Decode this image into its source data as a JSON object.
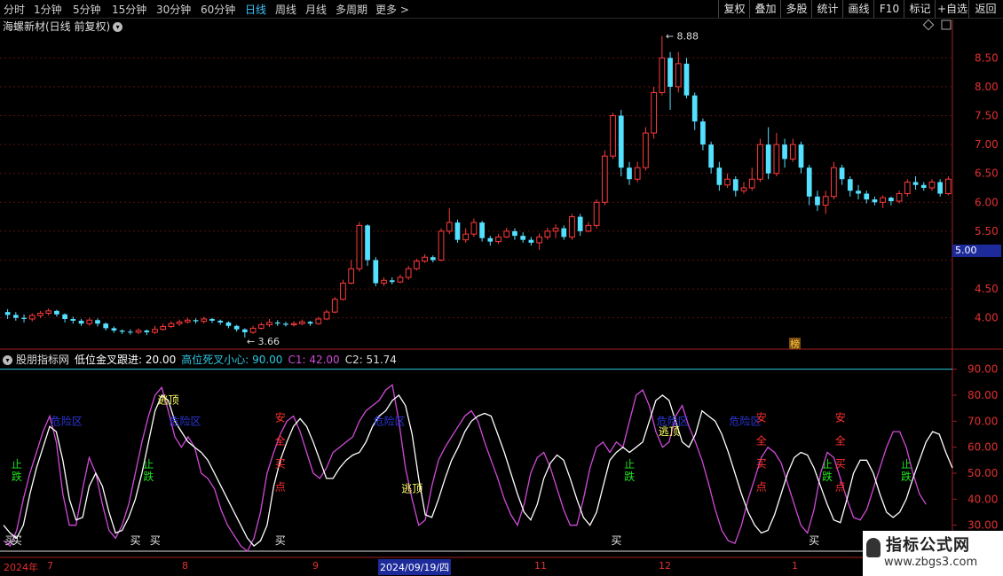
{
  "toolbar": {
    "timeframes": [
      "分时",
      "1分钟",
      "5分钟",
      "15分钟",
      "30分钟",
      "60分钟",
      "日线",
      "周线",
      "月线",
      "多周期",
      "更多 >"
    ],
    "active_timeframe": "日线",
    "buttons": [
      "复权",
      "叠加",
      "多股",
      "统计",
      "画线",
      "F10",
      "标记",
      "+自选",
      "返回"
    ]
  },
  "stock": {
    "title": "海螺新材(日线 前复权)",
    "high_mark": "8.88",
    "low_mark": "3.66",
    "bang": "榜"
  },
  "indicator": {
    "name": "股朋指标网",
    "p1": "低位金叉跟进: 20.00",
    "p2": "高位死叉小心: 90.00",
    "p3": "C1: 42.00",
    "p4": "C2: 51.74"
  },
  "price_axis": [
    "8.50",
    "8.00",
    "7.50",
    "7.00",
    "6.50",
    "6.00",
    "5.50",
    "5.00",
    "4.50",
    "4.00"
  ],
  "price_axis_current": "5.00",
  "osc_axis": [
    "90.00",
    "80.00",
    "70.00",
    "60.00",
    "50.00",
    "40.00",
    "30.00"
  ],
  "dates": {
    "year": "2024年",
    "m7": "7",
    "m8": "8",
    "m9": "9",
    "selected": "2024/09/19/四",
    "m11": "11",
    "m12": "12",
    "m1": "1"
  },
  "signals": {
    "escape": "逃顶",
    "danger": "危险区",
    "buy": "买",
    "stop_fall": [
      "止",
      "跌"
    ],
    "safe_buy": [
      "安",
      "全",
      "买",
      "点"
    ]
  },
  "watermark": {
    "line1": "指标公式网",
    "line2": "www.zbgs3.com"
  },
  "colors": {
    "up": "#ff3b3b",
    "down": "#54e0ff",
    "magenta": "#d04ad8",
    "white": "#ffffff",
    "cyan": "#2ec8e0",
    "blue": "#2b36d8",
    "yellow": "#ffff66",
    "green": "#20e020"
  },
  "chart_data": {
    "type": "candlestick",
    "ylim": [
      3.55,
      8.95
    ],
    "candles": [
      [
        4.1,
        4.05,
        4.15,
        3.98
      ],
      [
        4.05,
        4.0,
        4.1,
        3.95
      ],
      [
        4.0,
        3.98,
        4.06,
        3.92
      ],
      [
        3.98,
        4.04,
        4.08,
        3.94
      ],
      [
        4.04,
        4.08,
        4.12,
        4.0
      ],
      [
        4.08,
        4.12,
        4.16,
        4.04
      ],
      [
        4.12,
        4.06,
        4.14,
        4.02
      ],
      [
        4.06,
        3.98,
        4.08,
        3.92
      ],
      [
        3.98,
        3.95,
        4.02,
        3.9
      ],
      [
        3.95,
        3.9,
        3.98,
        3.86
      ],
      [
        3.9,
        3.96,
        4.0,
        3.86
      ],
      [
        3.96,
        3.9,
        3.99,
        3.85
      ],
      [
        3.9,
        3.82,
        3.92,
        3.78
      ],
      [
        3.82,
        3.78,
        3.85,
        3.74
      ],
      [
        3.78,
        3.76,
        3.8,
        3.72
      ],
      [
        3.76,
        3.75,
        3.8,
        3.71
      ],
      [
        3.75,
        3.78,
        3.82,
        3.72
      ],
      [
        3.78,
        3.75,
        3.8,
        3.7
      ],
      [
        3.75,
        3.8,
        3.86,
        3.72
      ],
      [
        3.8,
        3.85,
        3.9,
        3.78
      ],
      [
        3.85,
        3.9,
        3.94,
        3.82
      ],
      [
        3.9,
        3.93,
        3.97,
        3.86
      ],
      [
        3.93,
        3.96,
        4.0,
        3.9
      ],
      [
        3.96,
        3.94,
        3.99,
        3.9
      ],
      [
        3.94,
        3.98,
        4.02,
        3.9
      ],
      [
        3.98,
        3.95,
        4.0,
        3.91
      ],
      [
        3.95,
        3.92,
        3.97,
        3.88
      ],
      [
        3.92,
        3.86,
        3.94,
        3.82
      ],
      [
        3.86,
        3.8,
        3.88,
        3.76
      ],
      [
        3.8,
        3.75,
        3.82,
        3.66
      ],
      [
        3.75,
        3.82,
        3.86,
        3.72
      ],
      [
        3.82,
        3.88,
        3.92,
        3.8
      ],
      [
        3.88,
        3.92,
        3.98,
        3.84
      ],
      [
        3.92,
        3.9,
        3.96,
        3.86
      ],
      [
        3.9,
        3.88,
        3.93,
        3.85
      ],
      [
        3.88,
        3.9,
        3.94,
        3.85
      ],
      [
        3.9,
        3.93,
        3.97,
        3.87
      ],
      [
        3.93,
        3.9,
        3.95,
        3.86
      ],
      [
        3.9,
        3.98,
        4.02,
        3.88
      ],
      [
        3.98,
        4.1,
        4.14,
        3.96
      ],
      [
        4.1,
        4.32,
        4.36,
        4.08
      ],
      [
        4.32,
        4.6,
        4.66,
        4.3
      ],
      [
        4.6,
        4.85,
        5.0,
        4.58
      ],
      [
        4.85,
        5.6,
        5.66,
        4.8
      ],
      [
        5.6,
        5.0,
        5.62,
        4.9
      ],
      [
        5.0,
        4.6,
        5.05,
        4.55
      ],
      [
        4.6,
        4.65,
        4.7,
        4.55
      ],
      [
        4.65,
        4.62,
        4.7,
        4.58
      ],
      [
        4.62,
        4.7,
        4.75,
        4.6
      ],
      [
        4.7,
        4.85,
        4.9,
        4.66
      ],
      [
        4.85,
        4.98,
        5.02,
        4.82
      ],
      [
        4.98,
        5.05,
        5.1,
        4.95
      ],
      [
        5.05,
        5.0,
        5.08,
        4.96
      ],
      [
        5.0,
        5.5,
        5.55,
        4.98
      ],
      [
        5.5,
        5.65,
        5.9,
        5.45
      ],
      [
        5.65,
        5.35,
        5.7,
        5.3
      ],
      [
        5.35,
        5.45,
        5.55,
        5.3
      ],
      [
        5.45,
        5.65,
        5.72,
        5.4
      ],
      [
        5.65,
        5.38,
        5.68,
        5.32
      ],
      [
        5.38,
        5.32,
        5.42,
        5.25
      ],
      [
        5.32,
        5.4,
        5.45,
        5.28
      ],
      [
        5.4,
        5.5,
        5.56,
        5.38
      ],
      [
        5.5,
        5.42,
        5.55,
        5.35
      ],
      [
        5.42,
        5.35,
        5.48,
        5.3
      ],
      [
        5.35,
        5.3,
        5.4,
        5.25
      ],
      [
        5.3,
        5.4,
        5.46,
        5.18
      ],
      [
        5.4,
        5.5,
        5.56,
        5.35
      ],
      [
        5.5,
        5.55,
        5.62,
        5.38
      ],
      [
        5.55,
        5.4,
        5.6,
        5.35
      ],
      [
        5.4,
        5.75,
        5.8,
        5.35
      ],
      [
        5.75,
        5.5,
        5.8,
        5.42
      ],
      [
        5.5,
        5.6,
        5.66,
        5.48
      ],
      [
        5.6,
        6.0,
        6.05,
        5.55
      ],
      [
        6.0,
        6.8,
        6.9,
        5.95
      ],
      [
        6.8,
        7.5,
        7.55,
        6.75
      ],
      [
        7.5,
        6.6,
        7.6,
        6.45
      ],
      [
        6.6,
        6.4,
        6.7,
        6.3
      ],
      [
        6.4,
        6.6,
        6.7,
        6.35
      ],
      [
        6.6,
        7.2,
        7.3,
        6.55
      ],
      [
        7.2,
        7.9,
        8.0,
        7.1
      ],
      [
        7.9,
        8.5,
        8.88,
        7.85
      ],
      [
        8.5,
        8.0,
        8.6,
        7.6
      ],
      [
        8.0,
        8.4,
        8.6,
        7.9
      ],
      [
        8.4,
        7.85,
        8.5,
        7.8
      ],
      [
        7.85,
        7.4,
        7.9,
        7.25
      ],
      [
        7.4,
        7.0,
        7.45,
        6.9
      ],
      [
        7.0,
        6.6,
        7.05,
        6.5
      ],
      [
        6.6,
        6.3,
        6.7,
        6.2
      ],
      [
        6.3,
        6.4,
        6.5,
        6.25
      ],
      [
        6.4,
        6.2,
        6.45,
        6.1
      ],
      [
        6.2,
        6.25,
        6.35,
        6.15
      ],
      [
        6.25,
        6.4,
        6.6,
        6.2
      ],
      [
        6.4,
        7.0,
        7.1,
        6.35
      ],
      [
        7.0,
        6.5,
        7.3,
        6.4
      ],
      [
        6.5,
        7.0,
        7.2,
        6.45
      ],
      [
        7.0,
        6.75,
        7.1,
        6.6
      ],
      [
        6.75,
        7.0,
        7.1,
        6.7
      ],
      [
        7.0,
        6.6,
        7.05,
        6.5
      ],
      [
        6.6,
        6.1,
        6.65,
        5.95
      ],
      [
        6.1,
        5.95,
        6.2,
        5.85
      ],
      [
        5.95,
        6.1,
        6.2,
        5.8
      ],
      [
        6.1,
        6.6,
        6.7,
        6.05
      ],
      [
        6.6,
        6.4,
        6.65,
        6.3
      ],
      [
        6.4,
        6.2,
        6.45,
        6.1
      ],
      [
        6.2,
        6.15,
        6.3,
        6.05
      ],
      [
        6.15,
        6.05,
        6.2,
        5.98
      ],
      [
        6.05,
        6.0,
        6.1,
        5.95
      ],
      [
        6.0,
        6.08,
        6.12,
        5.9
      ],
      [
        6.08,
        6.02,
        6.1,
        5.95
      ],
      [
        6.02,
        6.15,
        6.2,
        5.98
      ],
      [
        6.15,
        6.35,
        6.4,
        6.1
      ],
      [
        6.35,
        6.3,
        6.45,
        6.22
      ],
      [
        6.3,
        6.25,
        6.35,
        6.2
      ],
      [
        6.25,
        6.35,
        6.4,
        6.2
      ],
      [
        6.35,
        6.15,
        6.4,
        6.1
      ],
      [
        6.15,
        6.4,
        6.45,
        6.12
      ]
    ],
    "osc_ylim": [
      20,
      95
    ],
    "osc_white": [
      30,
      27,
      25,
      30,
      42,
      52,
      60,
      68,
      66,
      55,
      40,
      32,
      33,
      45,
      50,
      45,
      35,
      27,
      28,
      33,
      40,
      50,
      62,
      74,
      80,
      78,
      70,
      66,
      62,
      60,
      58,
      55,
      50,
      45,
      40,
      35,
      30,
      25,
      22,
      24,
      30,
      45,
      55,
      62,
      68,
      71,
      68,
      62,
      55,
      48,
      48,
      52,
      55,
      57,
      58,
      62,
      68,
      72,
      74,
      78,
      80,
      76,
      65,
      48,
      34,
      33,
      40,
      48,
      55,
      60,
      66,
      70,
      72,
      73,
      72,
      65,
      58,
      50,
      42,
      35,
      32,
      38,
      48,
      54,
      57,
      55,
      48,
      40,
      33,
      30,
      35,
      45,
      55,
      58,
      60,
      58,
      60,
      62,
      70,
      78,
      80,
      78,
      70,
      62,
      60,
      65,
      74,
      72,
      70,
      65,
      58,
      50,
      42,
      35,
      30,
      27,
      28,
      34,
      42,
      50,
      56,
      58,
      57,
      52,
      45,
      38,
      32,
      31,
      40,
      50,
      55,
      55,
      50,
      42,
      35,
      33,
      35,
      40,
      48,
      55,
      62,
      66,
      65,
      58,
      52
    ],
    "osc_magenta": [
      24,
      22,
      28,
      40,
      50,
      58,
      66,
      72,
      62,
      42,
      30,
      30,
      44,
      56,
      50,
      38,
      28,
      25,
      30,
      38,
      50,
      62,
      72,
      80,
      83,
      74,
      64,
      60,
      64,
      60,
      50,
      48,
      44,
      36,
      30,
      26,
      22,
      20,
      25,
      35,
      50,
      58,
      65,
      70,
      72,
      66,
      58,
      50,
      48,
      52,
      58,
      60,
      62,
      64,
      70,
      74,
      76,
      78,
      82,
      84,
      70,
      52,
      40,
      30,
      32,
      45,
      55,
      60,
      64,
      68,
      72,
      74,
      70,
      62,
      55,
      48,
      40,
      34,
      30,
      38,
      50,
      56,
      58,
      52,
      44,
      36,
      30,
      30,
      40,
      52,
      60,
      62,
      58,
      62,
      60,
      70,
      80,
      82,
      76,
      66,
      60,
      62,
      72,
      76,
      68,
      62,
      55,
      46,
      36,
      28,
      24,
      23,
      30,
      40,
      48,
      56,
      60,
      58,
      54,
      46,
      38,
      30,
      27,
      36,
      50,
      58,
      56,
      48,
      40,
      33,
      32,
      36,
      44,
      52,
      60,
      66,
      66,
      60,
      50,
      42,
      38
    ],
    "signals_pos": {
      "escape": [
        25,
        62,
        101
      ],
      "danger": [
        9,
        27,
        58,
        101,
        112
      ],
      "buy": [
        1,
        2,
        20,
        23,
        42,
        93,
        123
      ],
      "stop": [
        2,
        22,
        95,
        125,
        137
      ],
      "safe": [
        42,
        115,
        127
      ]
    }
  }
}
